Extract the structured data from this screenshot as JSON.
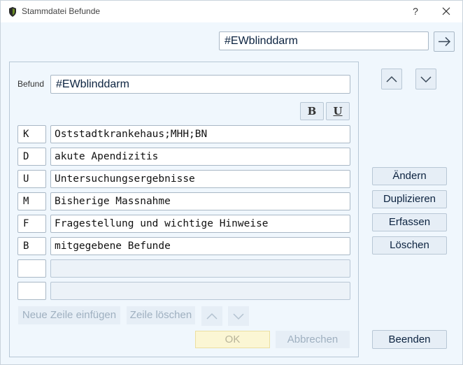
{
  "window": {
    "title": "Stammdatei Befunde",
    "help_label": "?"
  },
  "top_search": {
    "value": "#EWblinddarm"
  },
  "befund": {
    "label": "Befund",
    "value": "#EWblinddarm"
  },
  "format": {
    "bold_label": "B",
    "underline_label": "U"
  },
  "rows": [
    {
      "code": "K",
      "text": "Oststadtkrankehaus;MHH;BN"
    },
    {
      "code": "D",
      "text": "akute Apendizitis"
    },
    {
      "code": "U",
      "text": "Untersuchungsergebnisse"
    },
    {
      "code": "M",
      "text": "Bisherige Massnahme"
    },
    {
      "code": "F",
      "text": "Fragestellung und wichtige Hinweise"
    },
    {
      "code": "B",
      "text": "mitgegebene Befunde"
    },
    {
      "code": "",
      "text": ""
    },
    {
      "code": "",
      "text": ""
    }
  ],
  "row_buttons": {
    "insert_label": "Neue Zeile einfügen",
    "delete_label": "Zeile löschen"
  },
  "dialog_buttons": {
    "ok_label": "OK",
    "cancel_label": "Abbrechen"
  },
  "actions": {
    "change_label": "Ändern",
    "duplicate_label": "Duplizieren",
    "create_label": "Erfassen",
    "delete_label": "Löschen",
    "exit_label": "Beenden"
  },
  "colors": {
    "background": "#f0f7fd",
    "button": "#e6eef6",
    "ok_disabled": "#fbf6d4",
    "text_accent": "#0c2340"
  }
}
